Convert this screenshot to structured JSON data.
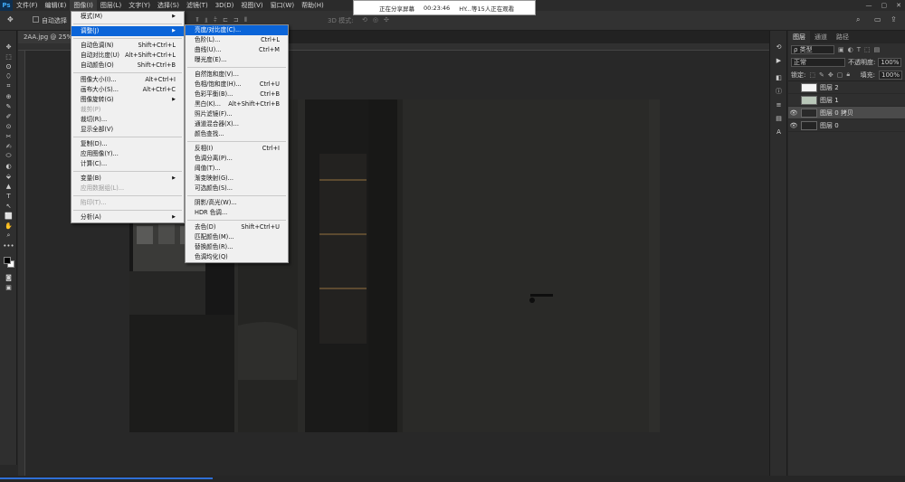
{
  "menubar": {
    "logo": "Ps",
    "items": [
      "文件(F)",
      "编辑(E)",
      "图像(I)",
      "图层(L)",
      "文字(Y)",
      "选择(S)",
      "滤镜(T)",
      "3D(D)",
      "视图(V)",
      "窗口(W)",
      "帮助(H)"
    ],
    "active_index": 2,
    "window_controls": [
      "—",
      "▢",
      "✕"
    ]
  },
  "options_bar": {
    "auto_select_label": "自动选择",
    "mode_label": "3D 模式:"
  },
  "share": {
    "status": "正在分享屏幕",
    "timer": "00:23:46",
    "viewers": "HY...等15人正在观看"
  },
  "document": {
    "tab_label": "2AA.jpg @ 25%"
  },
  "tools": [
    "✥",
    "⬚",
    "ʘ",
    "⬯",
    "⌗",
    "⊕",
    "✎",
    "✐",
    "⊙",
    "✂",
    "✍",
    "⬭",
    "◐",
    "⬙",
    "▲",
    "T",
    "↖",
    "⬜",
    "✋",
    "⌕",
    "•••"
  ],
  "image_menu": {
    "items": [
      {
        "label": "模式(M)",
        "shortcut": "",
        "submenu": true,
        "disabled": false,
        "sep_after": true
      },
      {
        "label": "调整(J)",
        "shortcut": "",
        "submenu": true,
        "disabled": false,
        "sep_after": true,
        "highlight": true
      },
      {
        "label": "自动色调(N)",
        "shortcut": "Shift+Ctrl+L",
        "submenu": false,
        "disabled": false
      },
      {
        "label": "自动对比度(U)",
        "shortcut": "Alt+Shift+Ctrl+L",
        "submenu": false,
        "disabled": false
      },
      {
        "label": "自动颜色(O)",
        "shortcut": "Shift+Ctrl+B",
        "submenu": false,
        "disabled": false,
        "sep_after": true
      },
      {
        "label": "图像大小(I)...",
        "shortcut": "Alt+Ctrl+I",
        "submenu": false,
        "disabled": false
      },
      {
        "label": "画布大小(S)...",
        "shortcut": "Alt+Ctrl+C",
        "submenu": false,
        "disabled": false
      },
      {
        "label": "图像旋转(G)",
        "shortcut": "",
        "submenu": true,
        "disabled": false
      },
      {
        "label": "裁剪(P)",
        "shortcut": "",
        "submenu": false,
        "disabled": true
      },
      {
        "label": "裁切(R)...",
        "shortcut": "",
        "submenu": false,
        "disabled": false
      },
      {
        "label": "显示全部(V)",
        "shortcut": "",
        "submenu": false,
        "disabled": false,
        "sep_after": true
      },
      {
        "label": "复制(D)...",
        "shortcut": "",
        "submenu": false,
        "disabled": false
      },
      {
        "label": "应用图像(Y)...",
        "shortcut": "",
        "submenu": false,
        "disabled": false
      },
      {
        "label": "计算(C)...",
        "shortcut": "",
        "submenu": false,
        "disabled": false,
        "sep_after": true
      },
      {
        "label": "变量(B)",
        "shortcut": "",
        "submenu": true,
        "disabled": false
      },
      {
        "label": "应用数据组(L)...",
        "shortcut": "",
        "submenu": false,
        "disabled": true,
        "sep_after": true
      },
      {
        "label": "陷印(T)...",
        "shortcut": "",
        "submenu": false,
        "disabled": true,
        "sep_after": true
      },
      {
        "label": "分析(A)",
        "shortcut": "",
        "submenu": true,
        "disabled": false
      }
    ]
  },
  "adjust_menu": {
    "items": [
      {
        "label": "亮度/对比度(C)...",
        "shortcut": "",
        "highlight": true
      },
      {
        "label": "色阶(L)...",
        "shortcut": "Ctrl+L"
      },
      {
        "label": "曲线(U)...",
        "shortcut": "Ctrl+M"
      },
      {
        "label": "曝光度(E)...",
        "shortcut": "",
        "sep_after": true
      },
      {
        "label": "自然饱和度(V)...",
        "shortcut": ""
      },
      {
        "label": "色相/饱和度(H)...",
        "shortcut": "Ctrl+U"
      },
      {
        "label": "色彩平衡(B)...",
        "shortcut": "Ctrl+B"
      },
      {
        "label": "黑白(K)...",
        "shortcut": "Alt+Shift+Ctrl+B"
      },
      {
        "label": "照片滤镜(F)...",
        "shortcut": ""
      },
      {
        "label": "通道混合器(X)...",
        "shortcut": ""
      },
      {
        "label": "颜色查找...",
        "shortcut": "",
        "sep_after": true
      },
      {
        "label": "反相(I)",
        "shortcut": "Ctrl+I"
      },
      {
        "label": "色调分离(P)...",
        "shortcut": ""
      },
      {
        "label": "阈值(T)...",
        "shortcut": ""
      },
      {
        "label": "渐变映射(G)...",
        "shortcut": ""
      },
      {
        "label": "可选颜色(S)...",
        "shortcut": "",
        "sep_after": true
      },
      {
        "label": "阴影/高光(W)...",
        "shortcut": ""
      },
      {
        "label": "HDR 色调...",
        "shortcut": "",
        "sep_after": true
      },
      {
        "label": "去色(D)",
        "shortcut": "Shift+Ctrl+U"
      },
      {
        "label": "匹配颜色(M)...",
        "shortcut": ""
      },
      {
        "label": "替换颜色(R)...",
        "shortcut": ""
      },
      {
        "label": "色调均化(Q)",
        "shortcut": ""
      }
    ]
  },
  "layers_panel": {
    "tabs": [
      "图层",
      "通道",
      "路径"
    ],
    "active_tab": 0,
    "filter_label": "ρ 类型",
    "blend_mode": "正常",
    "opacity_label": "不透明度:",
    "opacity_value": "100%",
    "lock_label": "锁定:",
    "fill_label": "填充:",
    "fill_value": "100%",
    "layers": [
      {
        "name": "图层 2",
        "visible": false,
        "selected": false,
        "thumb": "#f4f4f4"
      },
      {
        "name": "图层 1",
        "visible": false,
        "selected": false,
        "thumb": "#b9c7b9"
      },
      {
        "name": "图层 0 拷贝",
        "visible": true,
        "selected": true,
        "thumb": "#2a2a2a"
      },
      {
        "name": "图层 0",
        "visible": true,
        "selected": false,
        "thumb": "#242424"
      }
    ]
  }
}
